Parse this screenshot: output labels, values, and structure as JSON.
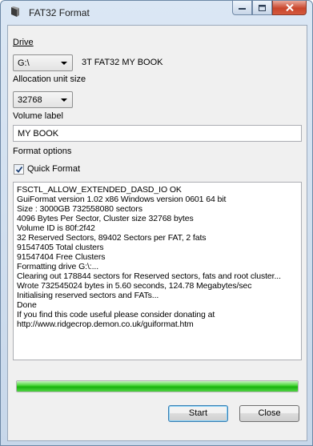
{
  "window": {
    "title": "FAT32 Format"
  },
  "drive": {
    "label": "Drive",
    "selected": "G:\\",
    "description": "3T FAT32 MY BOOK"
  },
  "allocation": {
    "label": "Allocation unit size",
    "selected": "32768"
  },
  "volume": {
    "label": "Volume label",
    "value": "MY BOOK"
  },
  "format_options": {
    "label": "Format options",
    "quick_format_label": "Quick Format",
    "quick_format_checked": true
  },
  "log": {
    "lines": [
      "FSCTL_ALLOW_EXTENDED_DASD_IO OK",
      "GuiFormat version 1.02 x86 Windows version 0601 64 bit",
      "Size : 3000GB 732558080 sectors",
      "4096 Bytes Per Sector, Cluster size 32768 bytes",
      "Volume ID is 80f:2f42",
      "32 Reserved Sectors, 89402 Sectors per FAT, 2 fats",
      "91547405 Total clusters",
      "91547404 Free Clusters",
      "Formatting drive G:\\:...",
      "Clearing out 178844 sectors for Reserved sectors, fats and root cluster...",
      "Wrote 732545024 bytes in 5.60 seconds, 124.78 Megabytes/sec",
      "Initialising reserved sectors and FATs...",
      "Done",
      "If you find this code useful please consider donating at",
      "http://www.ridgecrop.demon.co.uk/guiformat.htm"
    ]
  },
  "progress": {
    "percent": 100,
    "color": "#27c01a"
  },
  "buttons": {
    "start": "Start",
    "close": "Close"
  },
  "icons": {
    "app": "drive-format-icon",
    "minimize": "minimize-icon",
    "maximize": "maximize-icon",
    "close": "close-icon"
  }
}
